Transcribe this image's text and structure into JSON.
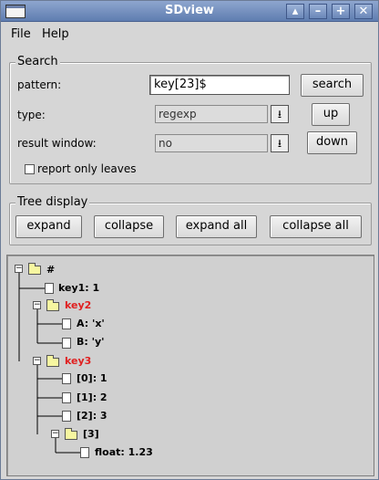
{
  "window": {
    "title": "SDview",
    "buttons": {
      "shade": "▴",
      "minimize": "–",
      "maximize": "+",
      "close": "✕"
    }
  },
  "menu": {
    "file": "File",
    "help": "Help"
  },
  "search": {
    "group_title": "Search",
    "pattern_label": "pattern:",
    "pattern_value": "key[23]$",
    "type_label": "type:",
    "type_value": "regexp",
    "result_window_label": "result window:",
    "result_window_value": "no",
    "report_only_leaves_label": "report only leaves",
    "report_only_leaves_checked": false,
    "search_button": "search",
    "up_button": "up",
    "down_button": "down"
  },
  "tree_display": {
    "group_title": "Tree display",
    "expand": "expand",
    "collapse": "collapse",
    "expand_all": "expand all",
    "collapse_all": "collapse all"
  },
  "tree": {
    "root": "#",
    "key1": "key1: 1",
    "key2": "key2",
    "key2_a": "A: 'x'",
    "key2_b": "B: 'y'",
    "key3": "key3",
    "key3_0": "[0]: 1",
    "key3_1": "[1]: 2",
    "key3_2": "[2]: 3",
    "key3_3": "[3]",
    "key3_3_float": "float: 1.23",
    "highlight_color": "#e02020"
  }
}
